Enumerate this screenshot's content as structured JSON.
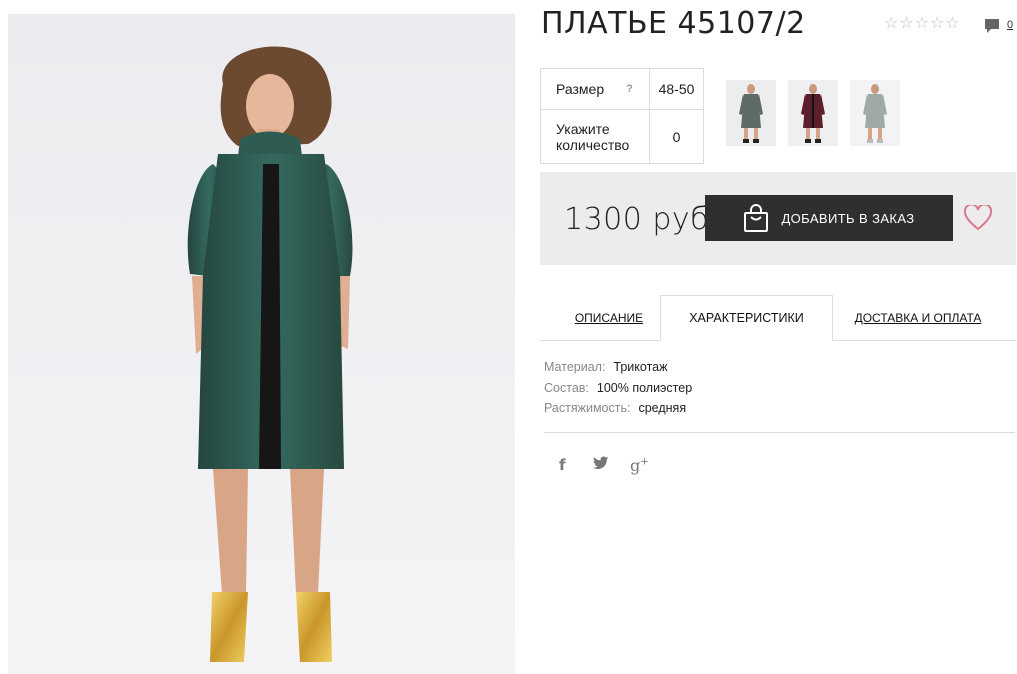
{
  "product": {
    "title": "ПЛАТЬЕ 45107/2",
    "rating_stars": [
      "☆",
      "☆",
      "☆",
      "☆",
      "☆"
    ],
    "comments_count": "0"
  },
  "options": {
    "size_label": "Размер",
    "size_help": "?",
    "size_value": "48-50",
    "qty_label": "Укажите количество",
    "qty_value": "0"
  },
  "thumbnails": [
    {
      "color": "#5f6b69",
      "name": "grey-dress"
    },
    {
      "color": "#5a1f2b",
      "name": "burgundy-dress"
    },
    {
      "color": "#9fa9a6",
      "name": "light-grey-dress"
    }
  ],
  "purchase": {
    "price": "1300 руб",
    "add_button_label": "ДОБАВИТЬ В ЗАКАЗ",
    "button_icon": "shopping-bag-icon",
    "wishlist_icon": "heart-icon"
  },
  "tabs": [
    {
      "label": "ОПИСАНИЕ",
      "active": false
    },
    {
      "label": "ХАРАКТЕРИСТИКИ",
      "active": true
    },
    {
      "label": "ДОСТАВКА И ОПЛАТА",
      "active": false
    }
  ],
  "characteristics": [
    {
      "key": "Материал:",
      "value": "Трикотаж"
    },
    {
      "key": "Состав:",
      "value": "100% полиэстер"
    },
    {
      "key": "Растяжимость:",
      "value": "средняя"
    }
  ],
  "social": {
    "facebook": "f",
    "twitter": "twitter-bird-icon",
    "googleplus": "g",
    "googleplus_sup": "+"
  },
  "colors": {
    "dress": "#2f5a52",
    "lace": "#1a1a1a",
    "button": "#2f2f2f",
    "heart": "#d9788a"
  }
}
